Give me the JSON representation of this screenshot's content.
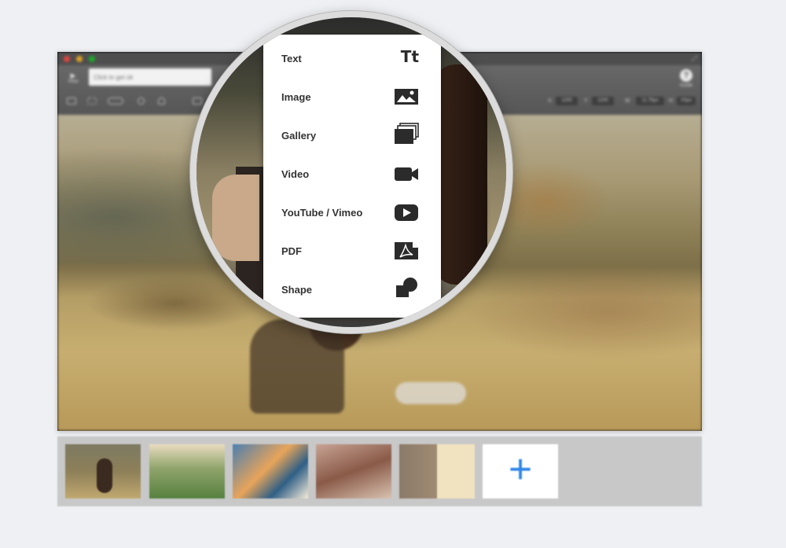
{
  "toolbar": {
    "view_label": "View",
    "title_placeholder": "Click to get ok",
    "help_label": "Guide",
    "num_fields": [
      "1200",
      "1200",
      "11.75px",
      "#Spx"
    ],
    "num_labels": [
      "X",
      "Y",
      "W",
      "H"
    ]
  },
  "menu": {
    "items": [
      {
        "label": "Text",
        "icon": "text-tt-icon"
      },
      {
        "label": "Image",
        "icon": "image-icon"
      },
      {
        "label": "Gallery",
        "icon": "gallery-icon"
      },
      {
        "label": "Video",
        "icon": "video-camera-icon"
      },
      {
        "label": "YouTube / Vimeo",
        "icon": "play-button-icon"
      },
      {
        "label": "PDF",
        "icon": "pdf-icon"
      },
      {
        "label": "Shape",
        "icon": "shape-icon"
      }
    ],
    "text_icon_glyph": "Tt"
  },
  "filmstrip": {
    "add_glyph": "+"
  },
  "colors": {
    "accent": "#2f86e8",
    "menu_text": "#333333",
    "toolbar": "#5e5e5e"
  }
}
